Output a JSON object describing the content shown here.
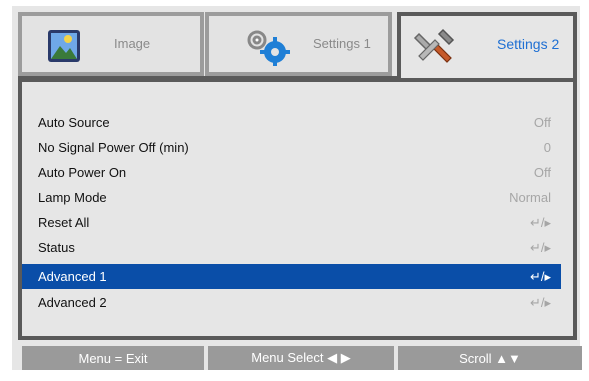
{
  "tabs": [
    {
      "label": "Image",
      "icon": "image-icon",
      "active": false
    },
    {
      "label": "Settings 1",
      "icon": "gears-icon",
      "active": false
    },
    {
      "label": "Settings 2",
      "icon": "tools-icon",
      "active": true
    }
  ],
  "menu": {
    "items": [
      {
        "name": "Auto Source",
        "value": "Off"
      },
      {
        "name": "No Signal Power Off (min)",
        "value": "0"
      },
      {
        "name": "Auto Power On",
        "value": "Off"
      },
      {
        "name": "Lamp Mode",
        "value": "Normal"
      },
      {
        "name": "Reset All",
        "value": "↵/▸"
      },
      {
        "name": "Status",
        "value": "↵/▸"
      },
      {
        "name": "Advanced 1",
        "value": "↵/▸",
        "selected": true
      },
      {
        "name": "Advanced 2",
        "value": "↵/▸"
      }
    ]
  },
  "footer": {
    "exit": "Menu = Exit",
    "select": "Menu Select ◀ ▶",
    "scroll": "Scroll ▲▼"
  },
  "colors": {
    "accent_tab": "#1e6fd3",
    "selected_row": "#0a4ea8",
    "footer_bg": "#9a9a9a",
    "panel_bg": "#e6e6e6"
  }
}
